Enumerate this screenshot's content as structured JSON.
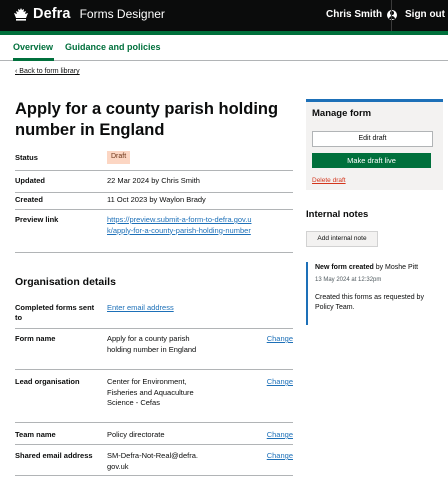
{
  "header": {
    "brand": "Defra",
    "product": "Forms Designer",
    "user_name": "Chris Smith",
    "sign_out": "Sign out"
  },
  "nav": {
    "overview": "Overview",
    "guidance": "Guidance and policies"
  },
  "back_link": "Back to form library",
  "page_title": "Apply for a county parish holding number in England",
  "summary": {
    "status_label": "Status",
    "status_value": "Draft",
    "updated_label": "Updated",
    "updated_value": "22 Mar 2024 by Chris Smith",
    "created_label": "Created",
    "created_value": "11 Oct 2023 by Waylon Brady",
    "preview_label": "Preview link",
    "preview_value": "https://preview.submit-a-form-to-defra.gov.uk/apply-for-a-county-parish-holding-number"
  },
  "org": {
    "heading": "Organisation details",
    "completed_label": "Completed forms sent to",
    "completed_value": "Enter email address",
    "form_name_label": "Form name",
    "form_name_value": "Apply for a county parish holding number in England",
    "lead_label": "Lead organisation",
    "lead_value": "Center for Environment, Fisheries and Aquaculture Science - Cefas",
    "team_label": "Team name",
    "team_value": "Policy directorate",
    "email_label": "Shared email address",
    "email_value": "SM-Defra-Not-Real@defra.gov.uk",
    "change": "Change"
  },
  "manage": {
    "heading": "Manage form",
    "edit_draft": "Edit draft",
    "make_live": "Make draft live",
    "delete_draft": "Delete draft"
  },
  "notes": {
    "heading": "Internal notes",
    "add_button": "Add internal note",
    "note_title": "New form created",
    "note_by": "by Moshe Pitt",
    "note_date": "13 May 2024 at 12:32pm",
    "note_body": "Created this forms as requested by Policy Team."
  },
  "colors": {
    "header_bg": "#0b0c0c",
    "accent_green": "#00703c",
    "link_blue": "#1d70b8",
    "draft_tag_bg": "#fcd6c3",
    "delete_red": "#d4351c"
  }
}
